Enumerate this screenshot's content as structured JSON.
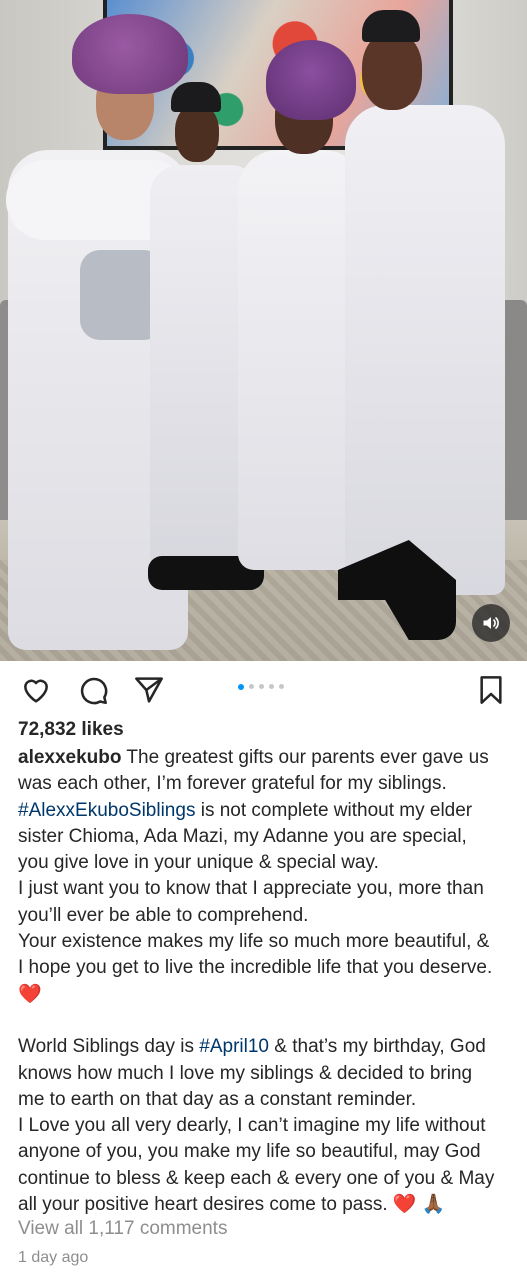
{
  "post": {
    "username": "alexxekubo",
    "likes_text": "72,832 likes",
    "carousel": {
      "total": 5,
      "active": 1
    },
    "caption_lines": [
      [
        {
          "t": "user",
          "v": "alexxekubo"
        },
        {
          "t": "text",
          "v": " The greatest gifts our parents ever gave us"
        }
      ],
      [
        {
          "t": "text",
          "v": "was each other, I’m forever grateful for my siblings."
        }
      ],
      [
        {
          "t": "tag",
          "v": "#AlexxEkuboSiblings"
        },
        {
          "t": "text",
          "v": " is not complete without my elder"
        }
      ],
      [
        {
          "t": "text",
          "v": "sister Chioma, Ada Mazi, my Adanne you are special,"
        }
      ],
      [
        {
          "t": "text",
          "v": "you give love in your unique & special way."
        }
      ],
      [
        {
          "t": "text",
          "v": "I just want you to know that I appreciate you, more than"
        }
      ],
      [
        {
          "t": "text",
          "v": "you’ll ever be able to comprehend."
        }
      ],
      [
        {
          "t": "text",
          "v": "Your existence makes my life so much more beautiful, &"
        }
      ],
      [
        {
          "t": "text",
          "v": "I hope you get to live the incredible life that you deserve."
        }
      ],
      [
        {
          "t": "heart",
          "v": "❤️"
        }
      ],
      [],
      [
        {
          "t": "text",
          "v": "World Siblings day is "
        },
        {
          "t": "tag",
          "v": "#April10"
        },
        {
          "t": "text",
          "v": " & that’s my birthday, God"
        }
      ],
      [
        {
          "t": "text",
          "v": "knows how much I love my siblings & decided to bring"
        }
      ],
      [
        {
          "t": "text",
          "v": "me to earth on that day as a constant reminder."
        }
      ],
      [
        {
          "t": "text",
          "v": "I Love you all very dearly, I can’t imagine my life without"
        }
      ],
      [
        {
          "t": "text",
          "v": "anyone of you, you make my life so beautiful, may God"
        }
      ],
      [
        {
          "t": "text",
          "v": "continue to bless & keep each & every one of you & May"
        }
      ],
      [
        {
          "t": "text",
          "v": "all your positive heart desires come to pass. "
        },
        {
          "t": "heart",
          "v": "❤️"
        },
        {
          "t": "text",
          "v": " "
        },
        {
          "t": "hands",
          "v": "🙏🏾"
        }
      ]
    ],
    "view_comments": "View all 1,117 comments",
    "time_ago": "1 day ago"
  },
  "icons": {
    "like": "heart-outline-icon",
    "comment": "comment-bubble-icon",
    "share": "paper-plane-icon",
    "save": "bookmark-outline-icon",
    "mute": "speaker-icon"
  },
  "colors": {
    "text": "#262626",
    "muted": "#8e8e8e",
    "hashtag": "#00376b",
    "carousel_active": "#0095f6",
    "carousel_inactive": "#c7c7c7",
    "heart": "#e0102c"
  }
}
